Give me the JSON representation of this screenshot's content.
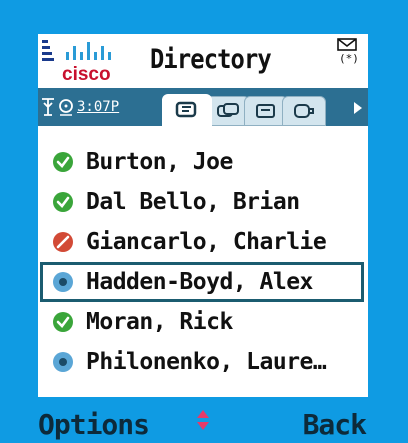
{
  "header": {
    "brand": "cisco",
    "title": "Directory"
  },
  "status": {
    "time": "3:07P"
  },
  "tabs": [
    {
      "icon": "directory-tab-icon",
      "active": true
    },
    {
      "icon": "contacts-tab-icon",
      "active": false
    },
    {
      "icon": "messages-tab-icon",
      "active": false
    },
    {
      "icon": "call-tab-icon",
      "active": false
    }
  ],
  "contacts": [
    {
      "name": "Burton, Joe",
      "presence": "available"
    },
    {
      "name": "Dal Bello, Brian",
      "presence": "available"
    },
    {
      "name": "Giancarlo, Charlie",
      "presence": "busy"
    },
    {
      "name": "Hadden-Boyd, Alex",
      "presence": "away",
      "selected": true
    },
    {
      "name": "Moran, Rick",
      "presence": "available"
    },
    {
      "name": "Philonenko, Laure…",
      "presence": "away"
    }
  ],
  "softkeys": {
    "left": "Options",
    "right": "Back"
  },
  "colors": {
    "background": "#0f9be3",
    "tabbar": "#2c6f92",
    "available": "#3aa53a",
    "busy": "#d24a36",
    "away": "#5aa6d6",
    "selection": "#1b5c70"
  }
}
